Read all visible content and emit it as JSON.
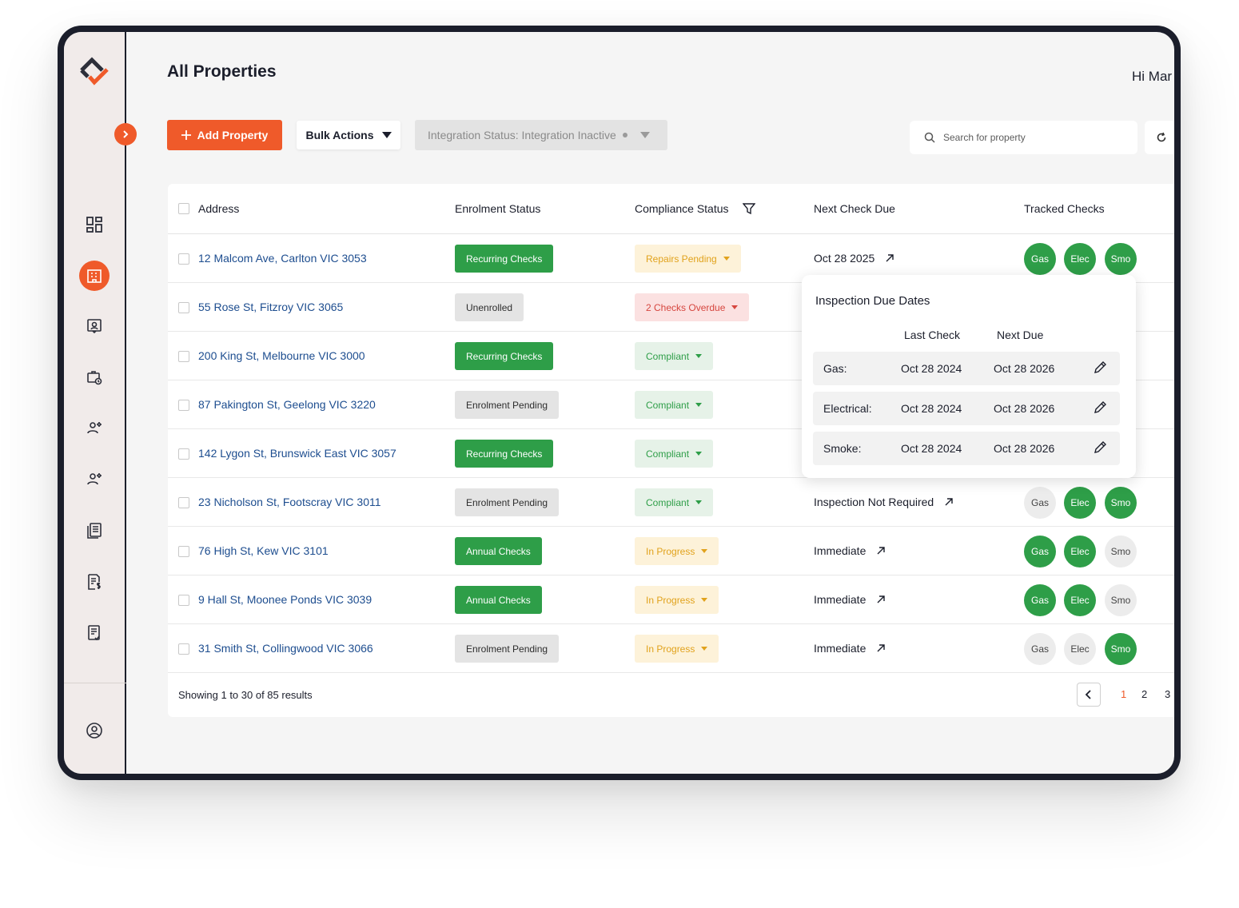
{
  "header": {
    "title": "All Properties",
    "greeting": "Hi Mar"
  },
  "toolbar": {
    "add_label": "Add Property",
    "bulk_label": "Bulk Actions",
    "integration_label": "Integration Status: Integration Inactive",
    "search_placeholder": "Search for property"
  },
  "table": {
    "headers": {
      "address": "Address",
      "enrolment": "Enrolment Status",
      "compliance": "Compliance Status",
      "next": "Next Check Due",
      "tracked": "Tracked Checks"
    },
    "tracked_labels": {
      "gas": "Gas",
      "elec": "Elec",
      "smo": "Smo"
    },
    "rows": [
      {
        "address": "12 Malcom Ave, Carlton VIC 3053",
        "enrolment": "Recurring Checks",
        "compliance": "Repairs Pending",
        "next": "Oct 28 2025"
      },
      {
        "address": "55 Rose St, Fitzroy VIC 3065",
        "enrolment": "Unenrolled",
        "compliance": "2 Checks Overdue",
        "next": ""
      },
      {
        "address": "200 King St, Melbourne VIC 3000",
        "enrolment": "Recurring Checks",
        "compliance": "Compliant",
        "next": ""
      },
      {
        "address": "87 Pakington St, Geelong VIC 3220",
        "enrolment": "Enrolment Pending",
        "compliance": "Compliant",
        "next": ""
      },
      {
        "address": "142 Lygon St, Brunswick East VIC 3057",
        "enrolment": "Recurring Checks",
        "compliance": "Compliant",
        "next": ""
      },
      {
        "address": "23 Nicholson St, Footscray VIC 3011",
        "enrolment": "Enrolment Pending",
        "compliance": "Compliant",
        "next": "Inspection Not Required"
      },
      {
        "address": "76 High St, Kew VIC 3101",
        "enrolment": "Annual Checks",
        "compliance": "In Progress",
        "next": "Immediate"
      },
      {
        "address": "9 Hall St, Moonee Ponds VIC 3039",
        "enrolment": "Annual Checks",
        "compliance": "In Progress",
        "next": "Immediate"
      },
      {
        "address": "31 Smith St, Collingwood VIC 3066",
        "enrolment": "Enrolment Pending",
        "compliance": "In Progress",
        "next": "Immediate"
      }
    ]
  },
  "popover": {
    "title": "Inspection Due Dates",
    "col_last": "Last Check",
    "col_next": "Next Due",
    "rows": [
      {
        "label": "Gas:",
        "last": "Oct 28 2024",
        "next": "Oct 28 2026"
      },
      {
        "label": "Electrical:",
        "last": "Oct 28 2024",
        "next": "Oct 28 2026"
      },
      {
        "label": "Smoke:",
        "last": "Oct 28 2024",
        "next": "Oct 28 2026"
      }
    ]
  },
  "footer": {
    "showing": "Showing  1 to 30 of 85 results",
    "pages": [
      "1",
      "2",
      "3"
    ]
  },
  "colors": {
    "accent": "#ef5a2a",
    "success": "#2e9e48",
    "link": "#1d4d8f",
    "warning": "#e1a21c",
    "danger": "#d6463f"
  }
}
